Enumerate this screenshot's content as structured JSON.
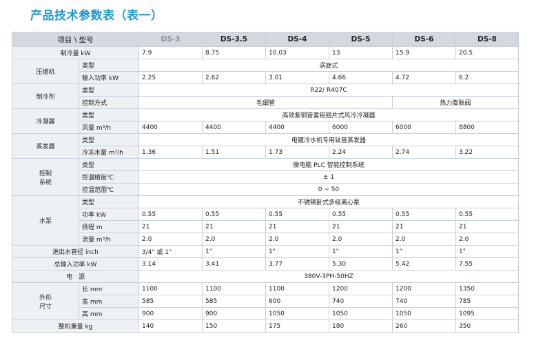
{
  "title": "产品技术参数表（表一）",
  "header": {
    "label": "项目 \\ 型号",
    "models": [
      "DS-3",
      "DS-3.5",
      "DS-4",
      "DS-5",
      "DS-6",
      "DS-8"
    ]
  },
  "cooling": {
    "label": "制冷量 kW",
    "values": [
      "7.9",
      "8.75",
      "10.03",
      "13",
      "15.9",
      "20.5"
    ]
  },
  "compressor": {
    "group": "压缩机",
    "type_label": "类型",
    "type_value": "涡旋式",
    "power_label": "输入功率 kW",
    "power_values": [
      "2.25",
      "2.62",
      "3.01",
      "4.66",
      "4.72",
      "6.2"
    ]
  },
  "refrigerant": {
    "group": "制冷剂",
    "type_label": "类型",
    "type_value": "R22/ R407C",
    "control_label": "控制方式",
    "control_a": "毛细管",
    "control_b": "热力膨胀阀"
  },
  "condenser": {
    "group": "冷凝器",
    "type_label": "类型",
    "type_value": "高效紫铜管套铝翅片式风冷冷凝器",
    "air_label": "风量 m³/h",
    "air_values": [
      "4400",
      "4400",
      "4400",
      "6000",
      "6000",
      "8800"
    ]
  },
  "evaporator": {
    "group": "蒸发器",
    "type_label": "类型",
    "type_value": "电镀冷水机专用钛管蒸发器",
    "flow_label": "冷冻水量 m³/h",
    "flow_values": [
      "1.36",
      "1.51",
      "1.73",
      "2.24",
      "2.74",
      "3.22"
    ]
  },
  "control": {
    "group_line1": "控制",
    "group_line2": "系统",
    "type_label": "类型",
    "type_value": "微电脑 PLC 智能控制系统",
    "precision_label": "控温精度℃",
    "precision_value": "± 1",
    "range_label": "控温范围℃",
    "range_value": "0 ~ 50"
  },
  "pump": {
    "group": "水泵",
    "type_label": "类型",
    "type_value": "不锈钢卧式多级离心泵",
    "power_label": "功率 kW",
    "power_values": [
      "0.55",
      "0.55",
      "0.55",
      "0.55",
      "0.55",
      "0.55"
    ],
    "head_label": "扬程 m",
    "head_values": [
      "21",
      "21",
      "21",
      "21",
      "21",
      "21"
    ],
    "flow_label": "流量 m³/h",
    "flow_values": [
      "2.0",
      "2.0",
      "2.0",
      "2.0",
      "2.0",
      "2.0"
    ]
  },
  "pipe": {
    "label": "进出水管径 inch",
    "values": [
      "3/4\" 或 1\"",
      "1\"",
      "1\"",
      "1\"",
      "1\"",
      "1\""
    ]
  },
  "total_power": {
    "label": "总输入功率 kW",
    "values": [
      "3.14",
      "3.41",
      "3.77",
      "5.30",
      "5.42",
      "7.55"
    ]
  },
  "power_supply": {
    "label": "电　源",
    "value": "380V-3PH-50HZ"
  },
  "dimensions": {
    "group_line1": "外形",
    "group_line2": "尺寸",
    "length_label": "长 mm",
    "length_values": [
      "1100",
      "1100",
      "1100",
      "1200",
      "1200",
      "1350"
    ],
    "width_label": "宽 mm",
    "width_values": [
      "585",
      "585",
      "600",
      "740",
      "740",
      "785"
    ],
    "height_label": "高 mm",
    "height_values": [
      "900",
      "900",
      "1050",
      "1050",
      "1050",
      "1095"
    ]
  },
  "weight": {
    "label": "整机重量 kg",
    "values": [
      "140",
      "150",
      "175",
      "180",
      "260",
      "350"
    ]
  }
}
